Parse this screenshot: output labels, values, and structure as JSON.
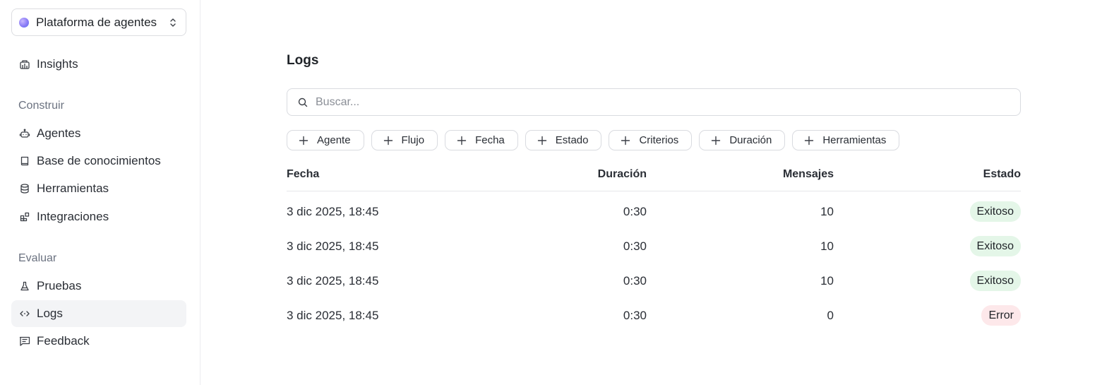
{
  "sidebar": {
    "workspace": {
      "name": "Plataforma de agentes"
    },
    "top_items": [
      {
        "label": "Insights",
        "icon": "insights-icon"
      }
    ],
    "sections": [
      {
        "title": "Construir",
        "items": [
          {
            "label": "Agentes",
            "icon": "robot-icon"
          },
          {
            "label": "Base de conocimientos",
            "icon": "book-icon"
          },
          {
            "label": "Herramientas",
            "icon": "database-icon"
          },
          {
            "label": "Integraciones",
            "icon": "integrations-icon"
          }
        ]
      },
      {
        "title": "Evaluar",
        "items": [
          {
            "label": "Pruebas",
            "icon": "flask-icon"
          },
          {
            "label": "Logs",
            "icon": "code-icon",
            "active": true
          },
          {
            "label": "Feedback",
            "icon": "message-icon"
          }
        ]
      }
    ]
  },
  "main": {
    "title": "Logs",
    "search": {
      "placeholder": "Buscar...",
      "value": ""
    },
    "filters": [
      "Agente",
      "Flujo",
      "Fecha",
      "Estado",
      "Criterios",
      "Duración",
      "Herramientas"
    ],
    "table": {
      "columns": [
        "Fecha",
        "Duración",
        "Mensajes",
        "Estado"
      ],
      "rows": [
        {
          "fecha": "3 dic 2025, 18:45",
          "duracion": "0:30",
          "mensajes": "10",
          "estado": "Exitoso",
          "status": "success"
        },
        {
          "fecha": "3 dic 2025, 18:45",
          "duracion": "0:30",
          "mensajes": "10",
          "estado": "Exitoso",
          "status": "success"
        },
        {
          "fecha": "3 dic 2025, 18:45",
          "duracion": "0:30",
          "mensajes": "10",
          "estado": "Exitoso",
          "status": "success"
        },
        {
          "fecha": "3 dic 2025, 18:45",
          "duracion": "0:30",
          "mensajes": "0",
          "estado": "Error",
          "status": "error"
        }
      ]
    }
  },
  "colors": {
    "success_badge": "#e4f6e8",
    "error_badge": "#fde8ea",
    "active_nav": "#f3f4f6",
    "border": "#d9dbe0"
  }
}
